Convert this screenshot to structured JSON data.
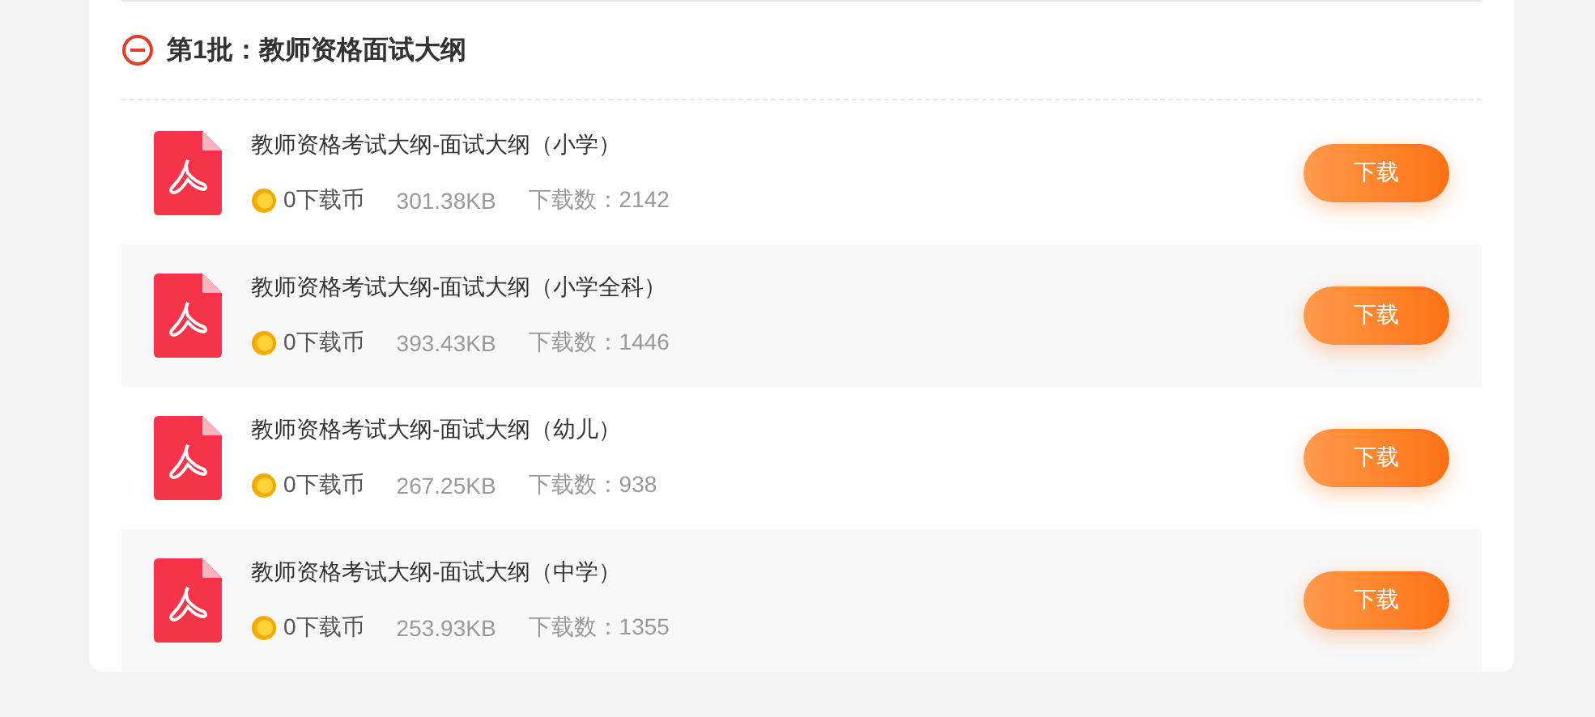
{
  "section": {
    "title": "第1批：教师资格面试大纲",
    "expanded": true,
    "files": [
      {
        "name": "教师资格考试大纲-面试大纲（小学）",
        "cost": "0下载币",
        "size": "301.38KB",
        "downloads": "下载数：2142",
        "button": "下载"
      },
      {
        "name": "教师资格考试大纲-面试大纲（小学全科）",
        "cost": "0下载币",
        "size": "393.43KB",
        "downloads": "下载数：1446",
        "button": "下载"
      },
      {
        "name": "教师资格考试大纲-面试大纲（幼儿）",
        "cost": "0下载币",
        "size": "267.25KB",
        "downloads": "下载数：938",
        "button": "下载"
      },
      {
        "name": "教师资格考试大纲-面试大纲（中学）",
        "cost": "0下载币",
        "size": "253.93KB",
        "downloads": "下载数：1355",
        "button": "下载"
      }
    ]
  }
}
